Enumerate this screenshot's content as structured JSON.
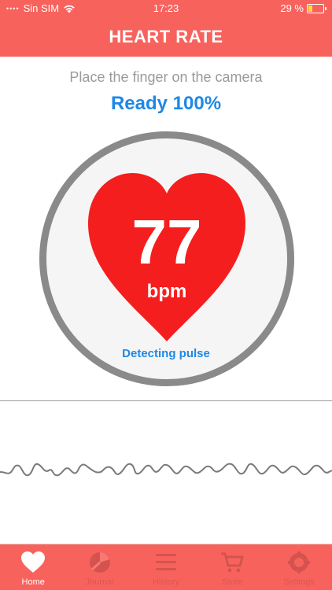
{
  "status_bar": {
    "carrier": "Sin SIM",
    "time": "17:23",
    "battery": "29 %",
    "battery_level": 0.29
  },
  "header": {
    "title": "HEART RATE"
  },
  "main": {
    "instruction": "Place the finger on the camera",
    "ready_text": "Ready 100%",
    "bpm_value": "77",
    "bpm_unit": "bpm",
    "detecting_text": "Detecting pulse"
  },
  "tabs": [
    {
      "label": "Home",
      "icon": "heart-icon",
      "active": true
    },
    {
      "label": "Journal",
      "icon": "journal-icon",
      "active": false
    },
    {
      "label": "History",
      "icon": "list-icon",
      "active": false
    },
    {
      "label": "Store",
      "icon": "cart-icon",
      "active": false
    },
    {
      "label": "Settings",
      "icon": "gear-icon",
      "active": false
    }
  ],
  "colors": {
    "brand": "#f8625d",
    "heart": "#f51e1e",
    "accent_blue": "#1e88e5",
    "dial_ring": "#8a8a8a"
  }
}
